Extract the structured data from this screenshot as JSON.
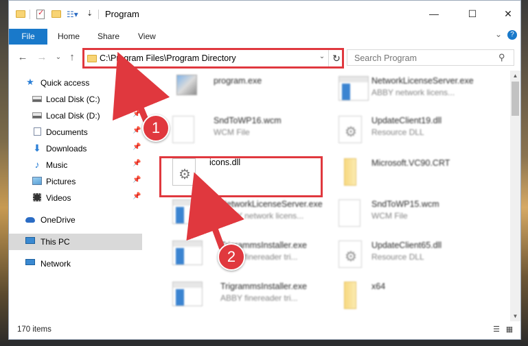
{
  "window": {
    "title": "Program",
    "controls": {
      "minimize": "—",
      "maximize": "☐",
      "close": "✕"
    },
    "help": "?",
    "expand": "⌄"
  },
  "ribbon": {
    "tabs": [
      "File",
      "Home",
      "Share",
      "View"
    ]
  },
  "address": {
    "path": "C:\\Program Files\\Program Directory",
    "dropdown": "⌄",
    "refresh": "↻"
  },
  "nav_arrows": {
    "back": "←",
    "forward": "→",
    "recent": "⌄",
    "up": "↑"
  },
  "search": {
    "placeholder": "Search Program",
    "icon": "search-icon"
  },
  "sidebar": {
    "items": [
      {
        "label": "Quick access",
        "icon": "star-icon"
      },
      {
        "label": "Local Disk (C:)",
        "icon": "disk-icon",
        "pinned": true
      },
      {
        "label": "Local Disk (D:)",
        "icon": "disk-icon",
        "pinned": true
      },
      {
        "label": "Documents",
        "icon": "documents-icon",
        "pinned": true
      },
      {
        "label": "Downloads",
        "icon": "downloads-icon",
        "pinned": true
      },
      {
        "label": "Music",
        "icon": "music-icon",
        "pinned": true
      },
      {
        "label": "Pictures",
        "icon": "pictures-icon",
        "pinned": true
      },
      {
        "label": "Videos",
        "icon": "videos-icon",
        "pinned": true
      },
      {
        "label": "OneDrive",
        "icon": "onedrive-icon"
      },
      {
        "label": "This PC",
        "icon": "pc-icon",
        "selected": true
      },
      {
        "label": "Network",
        "icon": "network-icon"
      }
    ]
  },
  "files": {
    "left": [
      {
        "name": "program.exe",
        "type": "",
        "icon": "program-icon"
      },
      {
        "name": "SndToWP16.wcm",
        "type": "WCM File",
        "icon": "page-icon"
      },
      {
        "name": "icons.dll",
        "type": "",
        "icon": "dll-gear-icon"
      },
      {
        "name": "NetworkLicenseServer.exe",
        "type": "ABBY network licens...",
        "icon": "exe-icon"
      },
      {
        "name": "TrigrammsInstaller.exe",
        "type": "ABBY finereader tri...",
        "icon": "exe-icon"
      },
      {
        "name": "TrigrammsInstaller.exe",
        "type": "ABBY finereader tri...",
        "icon": "exe-icon"
      }
    ],
    "right": [
      {
        "name": "NetworkLicenseServer.exe",
        "type": "ABBY network licens...",
        "icon": "exe-icon"
      },
      {
        "name": "UpdateClient19.dll",
        "type": "Resource DLL",
        "icon": "dll-gear-icon"
      },
      {
        "name": "Microsoft.VC90.CRT",
        "type": "",
        "icon": "folder-icon"
      },
      {
        "name": "SndToWP15.wcm",
        "type": "WCM File",
        "icon": "page-icon"
      },
      {
        "name": "UpdateClient65.dll",
        "type": "Resource DLL",
        "icon": "dll-gear-icon"
      },
      {
        "name": "x64",
        "type": "",
        "icon": "folder-icon"
      }
    ]
  },
  "status": {
    "items": "170 items"
  },
  "callouts": {
    "step1": "1",
    "step2": "2"
  },
  "colors": {
    "accent": "#1979ca",
    "annotation": "#e0383e",
    "selected": "#d9d9d9"
  }
}
